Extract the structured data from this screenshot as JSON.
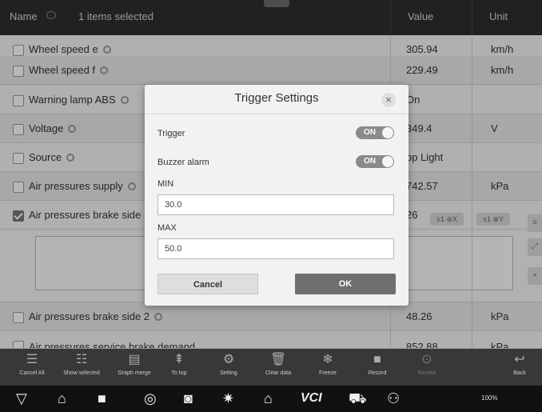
{
  "header": {
    "name": "Name",
    "selection": "1 items selected",
    "value": "Value",
    "unit": "Unit"
  },
  "rows": [
    {
      "label": "Wheel speed e",
      "value": "305.94",
      "unit": "km/h"
    },
    {
      "label": "Wheel speed f",
      "value": "229.49",
      "unit": "km/h"
    },
    {
      "label": "Warning lamp ABS",
      "value": "On",
      "unit": ""
    },
    {
      "label": "Voltage",
      "value": "349.4",
      "unit": "V"
    },
    {
      "label": "Source",
      "value": "op Light",
      "unit": ""
    },
    {
      "label": "Air pressures supply",
      "value": "742.57",
      "unit": "kPa"
    },
    {
      "label": "Air pressures brake side",
      "value": "26",
      "unit": ""
    },
    {
      "label": "Air pressures brake side 2",
      "value": "48.26",
      "unit": "kPa"
    },
    {
      "label": "Air pressures service brake demand",
      "value": "852.88",
      "unit": "kPa"
    }
  ],
  "graph_controls": {
    "zoom_x": "±1 ⊕X",
    "zoom_y": "±1 ⊕Y"
  },
  "dialog": {
    "title": "Trigger Settings",
    "trigger_label": "Trigger",
    "trigger_state": "ON",
    "buzzer_label": "Buzzer alarm",
    "buzzer_state": "ON",
    "min_label": "MIN",
    "min_value": "30.0",
    "max_label": "MAX",
    "max_value": "50.0",
    "cancel_label": "Cancel",
    "ok_label": "OK"
  },
  "toolbar": [
    {
      "name": "cancel-all",
      "label": "Cancel All",
      "icon": "list-icon",
      "enabled": true
    },
    {
      "name": "show-selected",
      "label": "Show selected",
      "icon": "list-check-icon",
      "enabled": true
    },
    {
      "name": "graph-merge",
      "label": "Graph merge",
      "icon": "graph-icon",
      "enabled": true
    },
    {
      "name": "to-top",
      "label": "To top",
      "icon": "arrow-up-icon",
      "enabled": true
    },
    {
      "name": "setting",
      "label": "Setting",
      "icon": "gear-icon",
      "enabled": true
    },
    {
      "name": "clear-data",
      "label": "Clear data",
      "icon": "trash-icon",
      "enabled": true
    },
    {
      "name": "freeze",
      "label": "Freeze",
      "icon": "snowflake-icon",
      "enabled": true
    },
    {
      "name": "record",
      "label": "Record",
      "icon": "video-icon",
      "enabled": true
    },
    {
      "name": "review",
      "label": "Review",
      "icon": "play-icon",
      "enabled": false
    },
    {
      "name": "back",
      "label": "Back",
      "icon": "back-arrow-icon",
      "enabled": true
    }
  ],
  "navbar": {
    "app_label": "VCI",
    "status": "100%"
  }
}
